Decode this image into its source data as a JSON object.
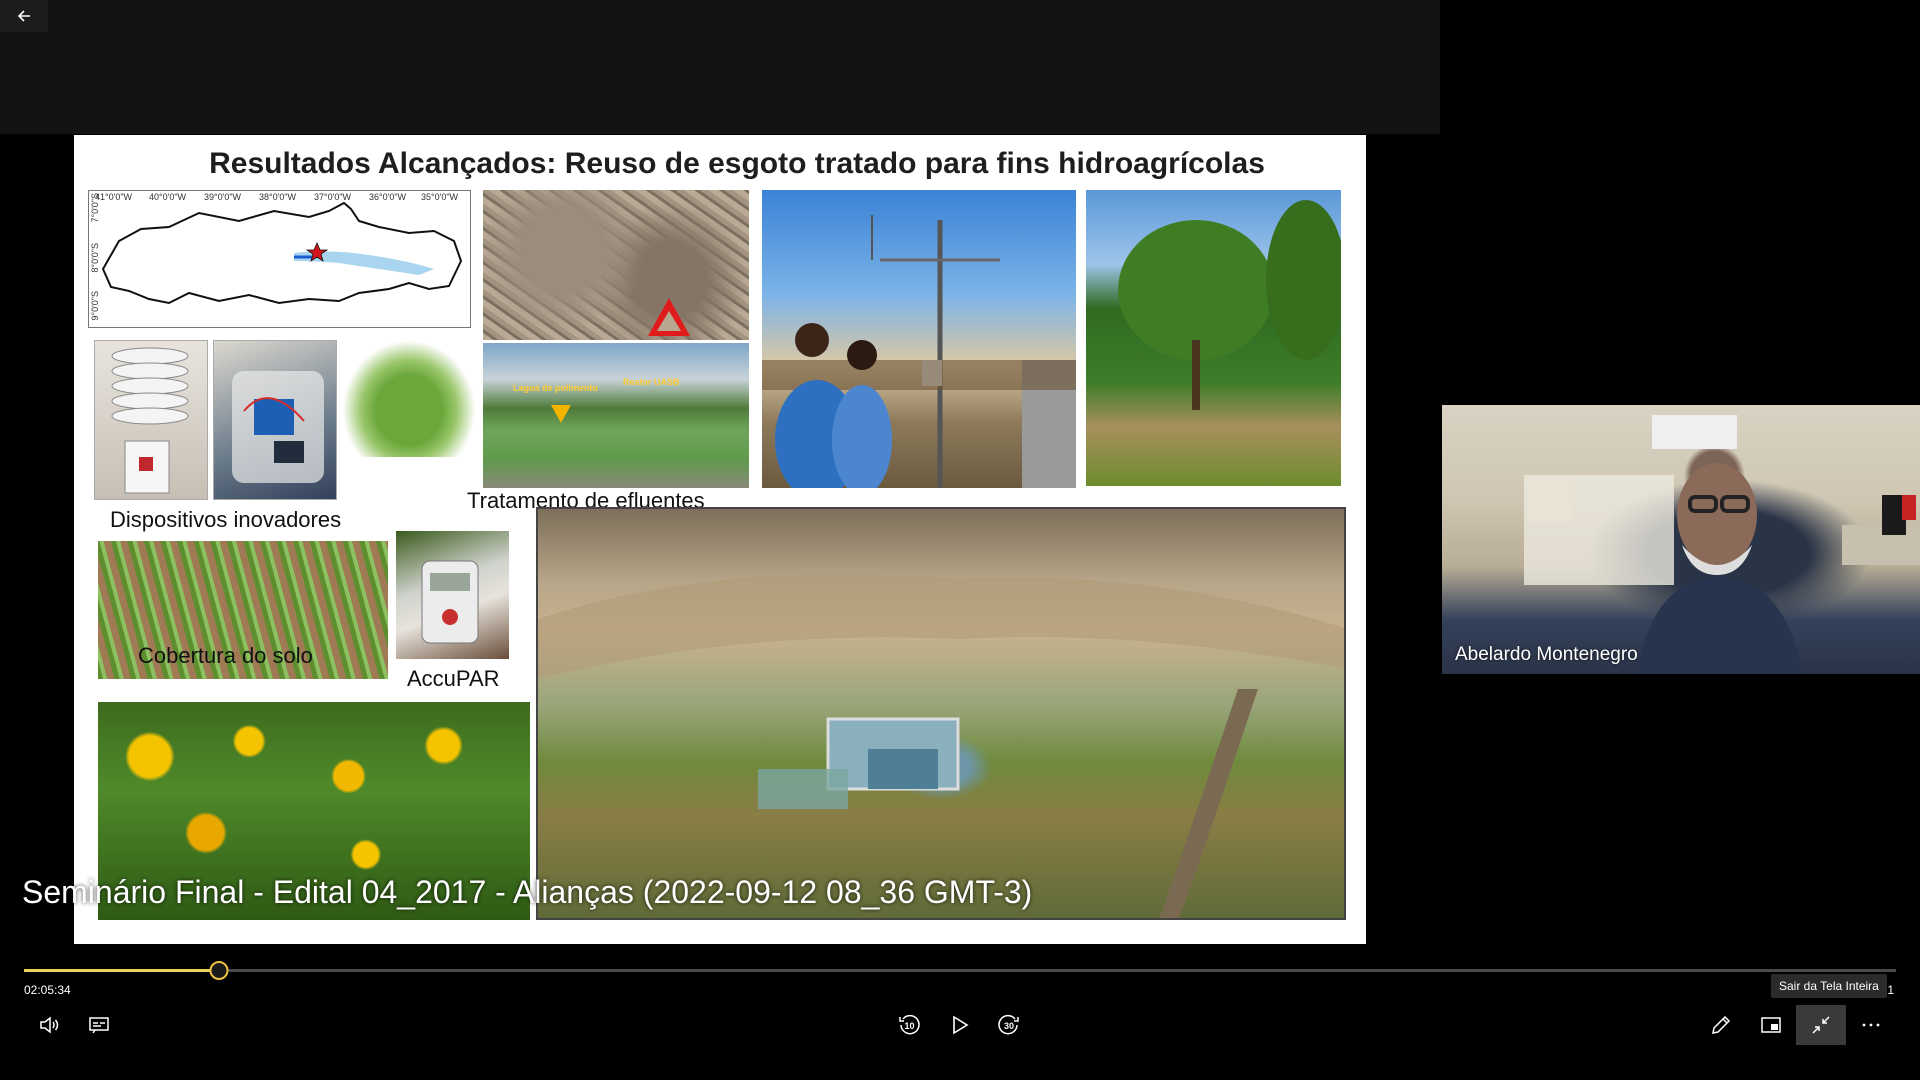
{
  "nav": {
    "back_icon": "back-arrow-icon"
  },
  "slide": {
    "title": "Resultados Alcançados:  Reuso de esgoto tratado para fins hidroagrícolas",
    "map_lon_ticks": [
      "41°0'0\"W",
      "40°0'0\"W",
      "39°0'0\"W",
      "38°0'0\"W",
      "37°0'0\"W",
      "36°0'0\"W",
      "35°0'0\"W"
    ],
    "map_lat_ticks": [
      "7°0'0\"S",
      "8°0'0\"S",
      "9°0'0\"S"
    ],
    "pool_labels": {
      "left": "Lagoa de polimento",
      "right": "Reator UASB"
    },
    "captions": {
      "devices": "Dispositivos inovadores",
      "effluent": "Tratamento de efluentes",
      "soil": "Cobertura do solo",
      "accupar": "AccuPAR"
    }
  },
  "video": {
    "title": "Seminário Final - Edital 04_2017 - Alianças  (2022-09-12 08_36 GMT-3)",
    "current_time": "02:05:34",
    "end_time_partial": "21",
    "progress_fraction": 0.104
  },
  "participant": {
    "name": "Abelardo Montenegro"
  },
  "tooltip": {
    "exit_fullscreen": "Sair da Tela Inteira"
  },
  "controls": {
    "left": [
      "volume-icon",
      "captions-icon"
    ],
    "center": [
      "rewind-10-icon",
      "play-icon",
      "forward-30-icon"
    ],
    "right": [
      "pen-icon",
      "miniplayer-icon",
      "exit-fullscreen-icon",
      "more-icon"
    ],
    "rewind_seconds": "10",
    "forward_seconds": "30"
  },
  "colors": {
    "progress_accent": "#f0d060",
    "title_accent": "#1e1e1e"
  }
}
